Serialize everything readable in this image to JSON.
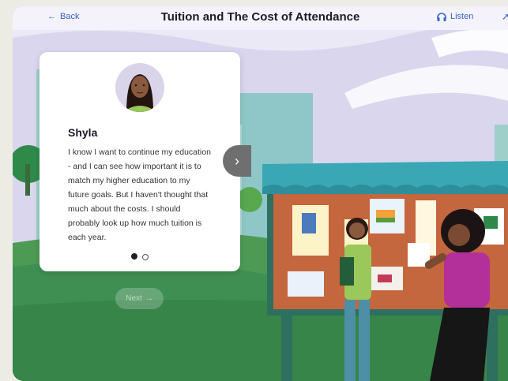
{
  "header": {
    "back_label": "Back",
    "title": "Tuition and The Cost of Attendance",
    "listen_label": "Listen"
  },
  "card": {
    "name": "Shyla",
    "quote": "I know I want to continue my education - and I can see how important it is to match my higher education to my future goals. But I haven't thought that much about the costs. I should probably look up how much tuition is each year."
  },
  "pager": {
    "total": 2,
    "current": 1
  },
  "footer": {
    "next_label": "Next"
  },
  "colors": {
    "accent": "#3b63c9",
    "grass": "#3f8f53",
    "roof": "#3aa7b5",
    "board": "#c4663e"
  }
}
